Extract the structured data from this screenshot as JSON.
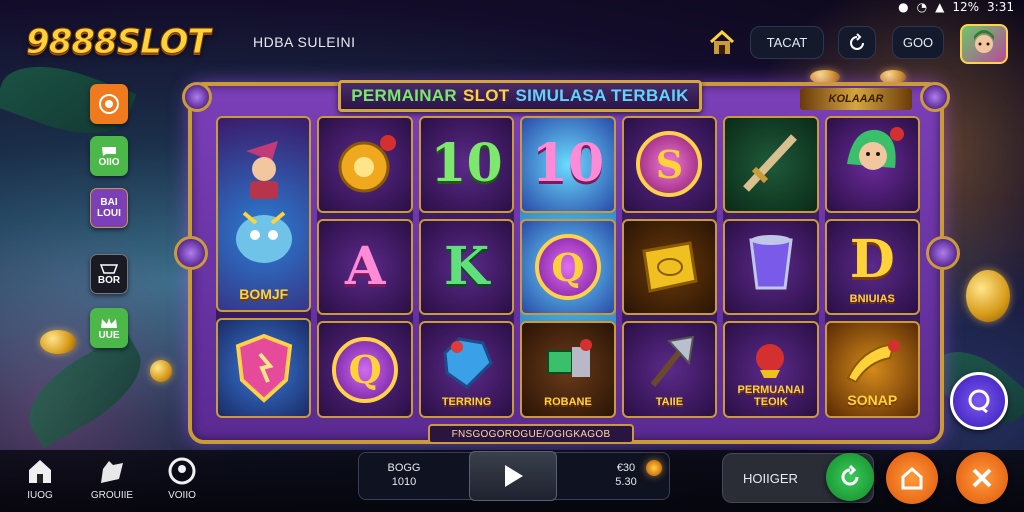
{
  "status": {
    "battery": "12%",
    "time": "3:31"
  },
  "header": {
    "logo": "9888SLOT",
    "subtitle": "HDBA SULEINI",
    "tacat_label": "TACAT",
    "goo_label": "GOO"
  },
  "side_menu": [
    {
      "label": "",
      "color": "#f07a1e",
      "icon": "coin-icon"
    },
    {
      "label": "OIIO",
      "color": "#4cb84a",
      "icon": "chat-icon"
    },
    {
      "label": "BAI LOUI",
      "color": "#7b3fb8",
      "icon": "text-icon"
    },
    {
      "label": "BOR",
      "color": "#1a1a24",
      "icon": "cup-icon"
    },
    {
      "label": "UUE",
      "color": "#4cb84a",
      "icon": "crown-icon"
    }
  ],
  "game": {
    "title_part1": "PERMAINAR",
    "title_part2": "SLOT",
    "title_part3": "SIMULASA TERBAIK",
    "brand_tag": "KOLAAAR",
    "bottom_strip": "FNSGOGOROGUE/OGIGKAGOB",
    "reels": [
      [
        {
          "type": "character",
          "caption": "BOMJF",
          "tall": true
        },
        {
          "type": "shield",
          "caption": ""
        }
      ],
      [
        {
          "type": "coin-bag",
          "caption": ""
        },
        {
          "type": "letter",
          "symbol": "A",
          "caption": ""
        },
        {
          "type": "orb",
          "symbol": "Q",
          "caption": ""
        }
      ],
      [
        {
          "type": "letter",
          "symbol": "10",
          "caption": ""
        },
        {
          "type": "letter",
          "symbol": "K",
          "caption": ""
        },
        {
          "type": "gem",
          "caption": "TERRING"
        }
      ],
      [
        {
          "type": "letter",
          "symbol": "10",
          "caption": ""
        },
        {
          "type": "orb",
          "symbol": "Q",
          "caption": ""
        },
        {
          "type": "potion",
          "caption": "ROBANE"
        }
      ],
      [
        {
          "type": "orb",
          "symbol": "S",
          "caption": ""
        },
        {
          "type": "gold-tile",
          "caption": ""
        },
        {
          "type": "axe",
          "caption": "TAIIE"
        }
      ],
      [
        {
          "type": "sword",
          "caption": ""
        },
        {
          "type": "cup",
          "caption": ""
        },
        {
          "type": "rose",
          "caption": "PERMUANAI TEOIK"
        }
      ],
      [
        {
          "type": "mermaid",
          "caption": ""
        },
        {
          "type": "letter",
          "symbol": "D",
          "caption": "BNIUIAS"
        },
        {
          "type": "horn",
          "caption": "SONAP"
        }
      ]
    ]
  },
  "bottom_nav": [
    {
      "label": "IUOG",
      "icon": "home-icon"
    },
    {
      "label": "GROUIIE",
      "icon": "hand-icon"
    },
    {
      "label": "VOIIO",
      "icon": "user-icon"
    }
  ],
  "controls": {
    "left_top": "BOGG",
    "left_bottom": "1010",
    "right_top": "€30",
    "right_bottom": "5.30",
    "mode_label": "HOIIGER"
  },
  "colors": {
    "accent": "#ffd23a",
    "frame": "#7b3fb8",
    "gold": "#c99b3b"
  }
}
